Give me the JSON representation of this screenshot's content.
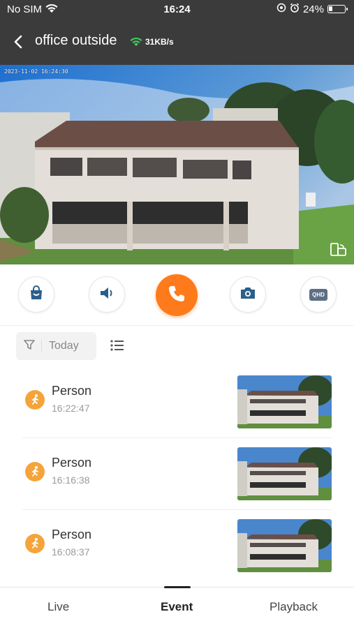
{
  "status": {
    "carrier": "No SIM",
    "time": "16:24",
    "battery_text": "24%",
    "battery_level": 0.24
  },
  "header": {
    "camera_name": "office outside",
    "speed": "31KB/s",
    "icons": [
      "back-arrow-icon",
      "wifi-signal-icon"
    ]
  },
  "video": {
    "osd_timestamp": "2023-11-02  16:24:30"
  },
  "controls": {
    "items": [
      "album-icon",
      "speaker-icon",
      "phone-call-icon",
      "camera-snapshot-icon",
      "qhd-quality-icon"
    ],
    "qhd_label": "QHD",
    "call_color": "#ff7a1a"
  },
  "filter": {
    "label": "Today"
  },
  "events": [
    {
      "type": "Person",
      "time": "16:22:47"
    },
    {
      "type": "Person",
      "time": "16:16:38"
    },
    {
      "type": "Person",
      "time": "16:08:37"
    }
  ],
  "tabs": {
    "live": "Live",
    "event": "Event",
    "playback": "Playback",
    "active": "Event"
  },
  "colors": {
    "accent": "#ff7a1a",
    "event_icon": "#f5a43a",
    "header_bg": "#3b3b3b"
  }
}
